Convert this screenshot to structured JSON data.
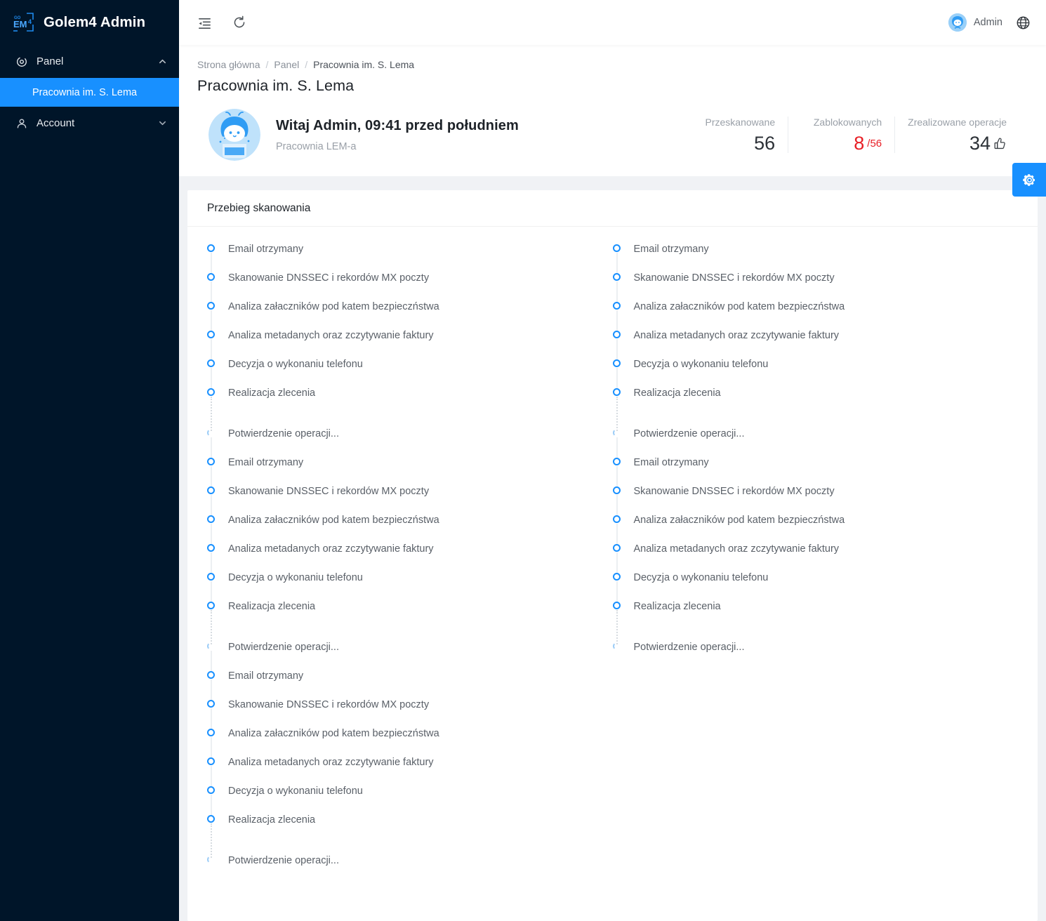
{
  "brand": {
    "title": "Golem4 Admin",
    "logo_icon": "golem4-logo-icon"
  },
  "sidebar": {
    "groups": [
      {
        "label": "Panel",
        "icon": "dashboard-icon",
        "caret": "chevron-up-icon",
        "expanded": true,
        "items": [
          {
            "label": "Pracownia im. S. Lema",
            "active": true
          }
        ]
      },
      {
        "label": "Account",
        "icon": "user-icon",
        "caret": "chevron-down-icon",
        "expanded": false,
        "items": []
      }
    ]
  },
  "topbar": {
    "collapse_icon": "menu-fold-icon",
    "reload_icon": "reload-icon",
    "user_name": "Admin",
    "avatar_icon": "avatar-icon",
    "language_icon": "globe-icon"
  },
  "breadcrumb": [
    {
      "label": "Strona główna"
    },
    {
      "label": "Panel"
    },
    {
      "label": "Pracownia im. S. Lema"
    }
  ],
  "breadcrumb_separator": "/",
  "page": {
    "title": "Pracownia im. S. Lema"
  },
  "hero": {
    "avatar_icon": "mascot-avatar-icon",
    "greeting": "Witaj Admin, 09:41 przed południem",
    "subtitle": "Pracownia LEM-a"
  },
  "stats": [
    {
      "label": "Przeskanowane",
      "value": "56",
      "suffix": "",
      "danger": false,
      "icon": ""
    },
    {
      "label": "Zablokowanych",
      "value": "8",
      "suffix": "/56",
      "danger": true,
      "icon": ""
    },
    {
      "label": "Zrealizowane operacje",
      "value": "34",
      "suffix": "",
      "danger": false,
      "icon": "thumbs-up-icon"
    }
  ],
  "card": {
    "title": "Przebieg skanowania"
  },
  "timeline_labels": {
    "email_received": "Email otrzymany",
    "dnssec_scan": "Skanowanie DNSSEC i rekordów MX poczty",
    "attachment_analysis": "Analiza załaczników pod katem bezpieczństwa",
    "metadata_analysis": "Analiza metadanych oraz zczytywanie faktury",
    "call_decision": "Decyzja o wykonaniu telefonu",
    "order_execution": "Realizacja zlecenia",
    "confirmation": "Potwierdzenie operacji..."
  },
  "timeline_columns": [
    {
      "name": "left-column",
      "items": [
        {
          "label": "Email otrzymany",
          "state": "done"
        },
        {
          "label": "Skanowanie DNSSEC i rekordów MX poczty",
          "state": "done"
        },
        {
          "label": "Analiza załaczników pod katem bezpieczństwa",
          "state": "done"
        },
        {
          "label": "Analiza metadanych oraz zczytywanie faktury",
          "state": "done"
        },
        {
          "label": "Decyzja o wykonaniu telefonu",
          "state": "done"
        },
        {
          "label": "Realizacja zlecenia",
          "state": "gap"
        },
        {
          "label": "Potwierdzenie operacji...",
          "state": "pending"
        },
        {
          "label": "Email otrzymany",
          "state": "done"
        },
        {
          "label": "Skanowanie DNSSEC i rekordów MX poczty",
          "state": "done"
        },
        {
          "label": "Analiza załaczników pod katem bezpieczństwa",
          "state": "done"
        },
        {
          "label": "Analiza metadanych oraz zczytywanie faktury",
          "state": "done"
        },
        {
          "label": "Decyzja o wykonaniu telefonu",
          "state": "done"
        },
        {
          "label": "Realizacja zlecenia",
          "state": "gap"
        },
        {
          "label": "Potwierdzenie operacji...",
          "state": "pending"
        },
        {
          "label": "Email otrzymany",
          "state": "done"
        },
        {
          "label": "Skanowanie DNSSEC i rekordów MX poczty",
          "state": "done"
        },
        {
          "label": "Analiza załaczników pod katem bezpieczństwa",
          "state": "done"
        },
        {
          "label": "Analiza metadanych oraz zczytywanie faktury",
          "state": "done"
        },
        {
          "label": "Decyzja o wykonaniu telefonu",
          "state": "done"
        },
        {
          "label": "Realizacja zlecenia",
          "state": "gap"
        },
        {
          "label": "Potwierdzenie operacji...",
          "state": "pending"
        }
      ]
    },
    {
      "name": "right-column",
      "items": [
        {
          "label": "Email otrzymany",
          "state": "done"
        },
        {
          "label": "Skanowanie DNSSEC i rekordów MX poczty",
          "state": "done"
        },
        {
          "label": "Analiza załaczników pod katem bezpieczństwa",
          "state": "done"
        },
        {
          "label": "Analiza metadanych oraz zczytywanie faktury",
          "state": "done"
        },
        {
          "label": "Decyzja o wykonaniu telefonu",
          "state": "done"
        },
        {
          "label": "Realizacja zlecenia",
          "state": "gap"
        },
        {
          "label": "Potwierdzenie operacji...",
          "state": "pending"
        },
        {
          "label": "Email otrzymany",
          "state": "done"
        },
        {
          "label": "Skanowanie DNSSEC i rekordów MX poczty",
          "state": "done"
        },
        {
          "label": "Analiza załaczników pod katem bezpieczństwa",
          "state": "done"
        },
        {
          "label": "Analiza metadanych oraz zczytywanie faktury",
          "state": "done"
        },
        {
          "label": "Decyzja o wykonaniu telefonu",
          "state": "done"
        },
        {
          "label": "Realizacja zlecenia",
          "state": "gap"
        },
        {
          "label": "Potwierdzenie operacji...",
          "state": "pending"
        }
      ]
    }
  ],
  "settings_fab": {
    "icon": "gear-icon",
    "label": "Ustawienia"
  },
  "colors": {
    "accent": "#1890ff",
    "sidebar_bg": "#001529",
    "page_bg": "#f0f2f5",
    "danger": "#e81f26",
    "text": "#5a6068"
  }
}
